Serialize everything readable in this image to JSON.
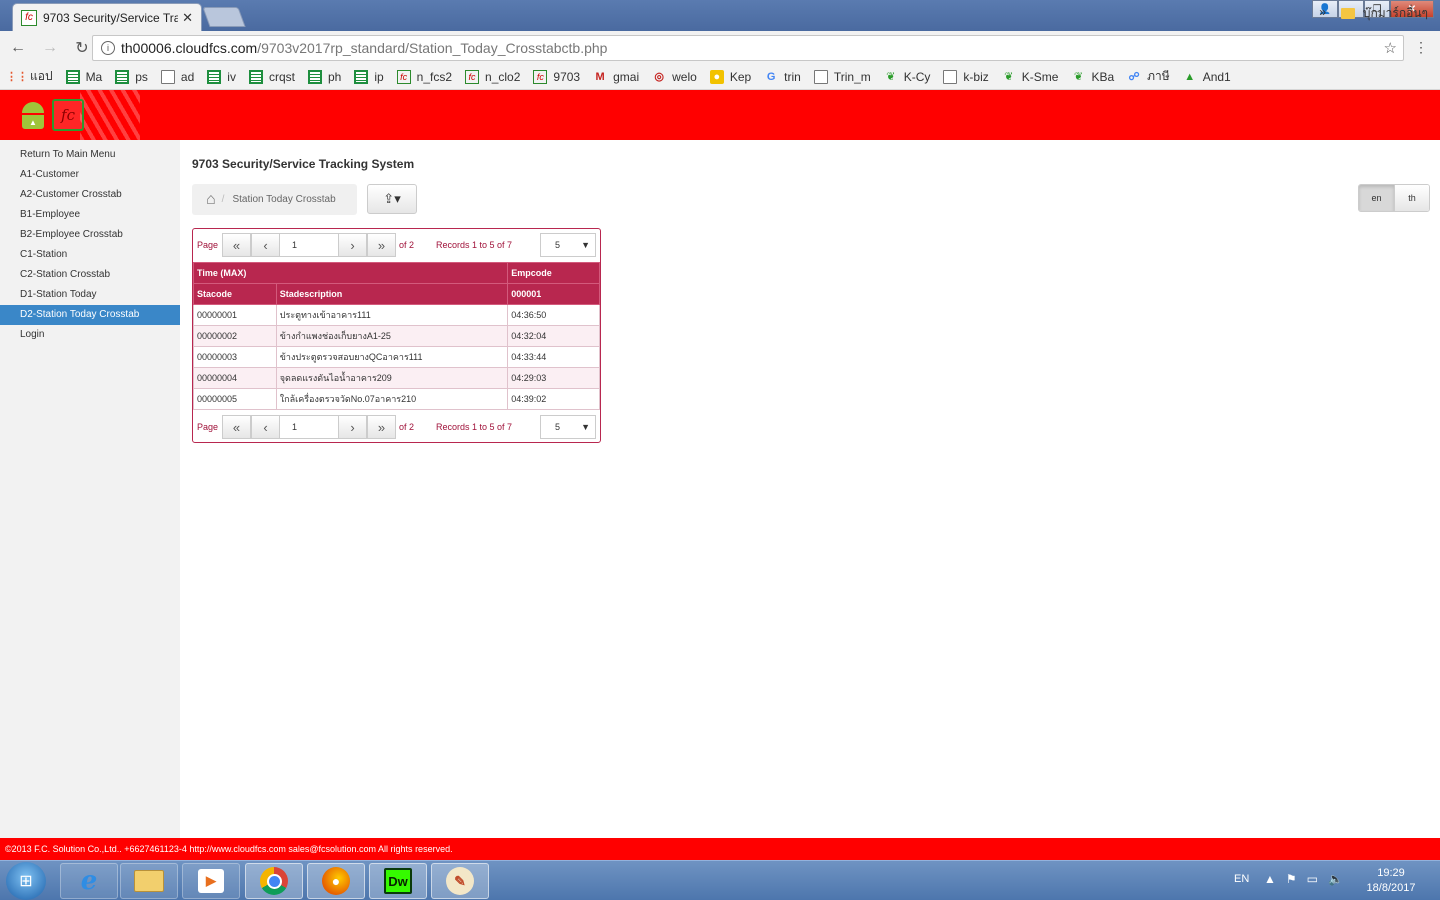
{
  "browser": {
    "tab_title": "9703 Security/Service Tra",
    "tab_favicon": "fc",
    "url_host": "th00006.cloudfcs.com",
    "url_path": "/9703v2017rp_standard/Station_Today_Crosstabctb.php",
    "bookmarks": [
      {
        "label": "แอป",
        "icon": "apps-icon"
      },
      {
        "label": "Ma",
        "icon": "sheet-icon"
      },
      {
        "label": "ps",
        "icon": "sheet-icon"
      },
      {
        "label": "ad",
        "icon": "doc-icon"
      },
      {
        "label": "iv",
        "icon": "sheet-icon"
      },
      {
        "label": "crqst",
        "icon": "sheet-icon"
      },
      {
        "label": "ph",
        "icon": "sheet-icon"
      },
      {
        "label": "ip",
        "icon": "sheet-icon"
      },
      {
        "label": "n_fcs2",
        "icon": "fc-icon"
      },
      {
        "label": "n_clo2",
        "icon": "fc-icon"
      },
      {
        "label": "9703",
        "icon": "fc-icon"
      },
      {
        "label": "gmai",
        "icon": "gmail-icon"
      },
      {
        "label": "welo",
        "icon": "bag-icon"
      },
      {
        "label": "Kep",
        "icon": "bulb-icon"
      },
      {
        "label": "trin",
        "icon": "google-icon"
      },
      {
        "label": "Trin_m",
        "icon": "doc-icon"
      },
      {
        "label": "K-Cy",
        "icon": "kbank-icon"
      },
      {
        "label": "k-biz",
        "icon": "doc-icon"
      },
      {
        "label": "K-Sme",
        "icon": "kbank-icon"
      },
      {
        "label": "KBa",
        "icon": "kbank-icon"
      },
      {
        "label": "ภาษี",
        "icon": "tax-icon"
      },
      {
        "label": "And1",
        "icon": "android-icon"
      }
    ],
    "bookmark_overflow": "»",
    "bookmark_folder": "บุ๊กมาร์กอื่นๆ"
  },
  "app": {
    "logo_text": "fc",
    "title": "9703 Security/Service Tracking System",
    "breadcrumb": "Station Today Crosstab",
    "languages": [
      "en",
      "th"
    ],
    "active_language": "en",
    "footer": "©2013 F.C. Solution Co.,Ltd.. +6627461123-4 http://www.cloudfcs.com sales@fcsolution.com All rights reserved."
  },
  "sidebar": {
    "items": [
      "Return To Main Menu",
      "A1-Customer",
      "A2-Customer Crosstab",
      "B1-Employee",
      "B2-Employee Crosstab",
      "C1-Station",
      "C2-Station Crosstab",
      "D1-Station Today",
      "D2-Station Today Crosstab",
      "Login"
    ],
    "active_index": 8
  },
  "grid": {
    "pager": {
      "page_label": "Page",
      "page_value": "1",
      "of_label": "of 2",
      "records_label": "Records 1 to 5 of 7",
      "page_size": "5"
    },
    "header_top": {
      "left": "Time (MAX)",
      "right": "Empcode"
    },
    "columns": [
      "Stacode",
      "Stadescription",
      "000001"
    ],
    "rows": [
      [
        "00000001",
        "ประตูทางเข้าอาคาร111",
        "04:36:50"
      ],
      [
        "00000002",
        "ข้างกำแพงช่องเก็บยางA1-25",
        "04:32:04"
      ],
      [
        "00000003",
        "ข้างประตูตรวจสอบยางQCอาคาร111",
        "04:33:44"
      ],
      [
        "00000004",
        "จุดลดแรงดันไอน้ำอาคาร209",
        "04:29:03"
      ],
      [
        "00000005",
        "ใกล้เครื่องตรวจวัดNo.07อาคาร210",
        "04:39:02"
      ]
    ]
  },
  "taskbar": {
    "language": "EN",
    "time": "19:29",
    "date": "18/8/2017",
    "apps": [
      "ie-icon",
      "explorer-icon",
      "media-player-icon",
      "chrome-icon",
      "firefox-icon",
      "dreamweaver-icon",
      "paint-icon"
    ],
    "dreamweaver_label": "Dw"
  },
  "colors": {
    "header_red": "#ff0000",
    "grid_accent": "#b8274f",
    "sidebar_active": "#3a87c8"
  }
}
